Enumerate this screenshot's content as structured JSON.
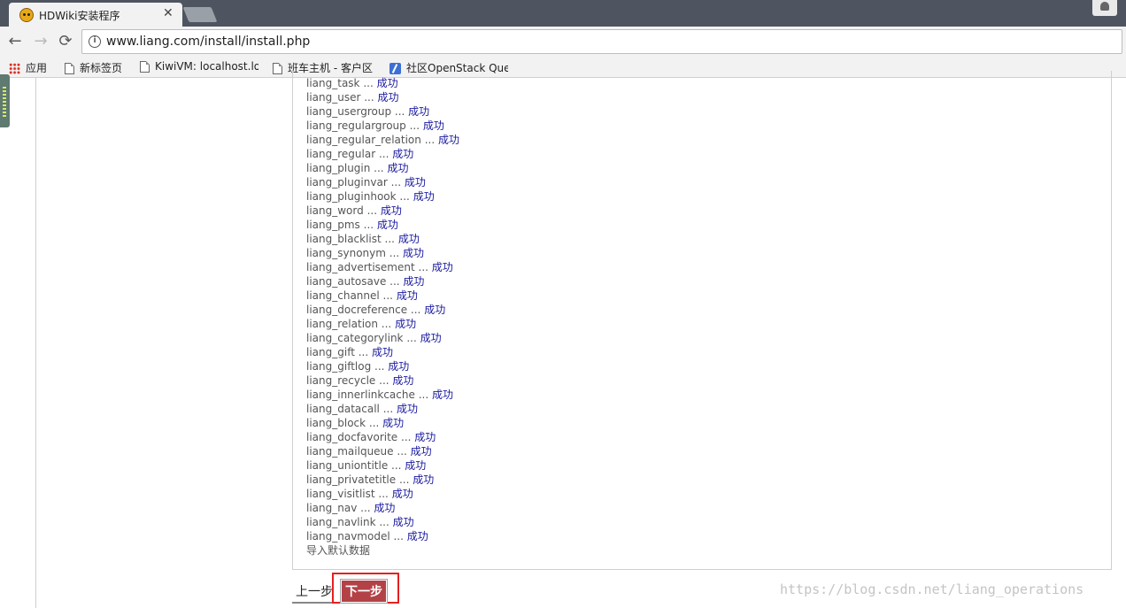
{
  "browser": {
    "tab_title": "HDWiki安装程序",
    "tab_close": "✕",
    "back": "←",
    "forward": "→",
    "reload": "⟳",
    "url": "www.liang.com/install/install.php",
    "bookmarks": [
      {
        "label": "应用",
        "icon": "apps-icon"
      },
      {
        "label": "新标签页",
        "icon": "page-icon"
      },
      {
        "label": "KiwiVM: localhost.lo",
        "icon": "page-icon"
      },
      {
        "label": "班车主机 - 客户区",
        "icon": "page-icon"
      },
      {
        "label": "社区OpenStack Que",
        "icon": "openstack-icon"
      }
    ]
  },
  "install_log": {
    "status_text": "成功",
    "tables": [
      "liang_task",
      "liang_user",
      "liang_usergroup",
      "liang_regulargroup",
      "liang_regular_relation",
      "liang_regular",
      "liang_plugin",
      "liang_pluginvar",
      "liang_pluginhook",
      "liang_word",
      "liang_pms",
      "liang_blacklist",
      "liang_synonym",
      "liang_advertisement",
      "liang_autosave",
      "liang_channel",
      "liang_docreference",
      "liang_relation",
      "liang_categorylink",
      "liang_gift",
      "liang_giftlog",
      "liang_recycle",
      "liang_innerlinkcache",
      "liang_datacall",
      "liang_block",
      "liang_docfavorite",
      "liang_mailqueue",
      "liang_uniontitle",
      "liang_privatetitle",
      "liang_visitlist",
      "liang_nav",
      "liang_navlink",
      "liang_navmodel"
    ],
    "final_line": "导入默认数据"
  },
  "buttons": {
    "prev": "上一步",
    "next": "下一步"
  },
  "watermark": "https://blog.csdn.net/liang_operations",
  "colors": {
    "success_text": "#1a1aa0",
    "next_button": "#b34247",
    "highlight_box": "#e52020"
  }
}
